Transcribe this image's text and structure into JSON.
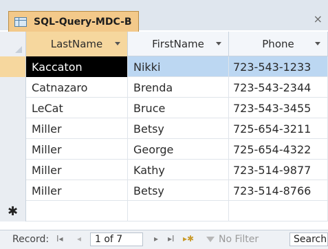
{
  "tab": {
    "title": "SQL-Query-MDC-B",
    "close": "×"
  },
  "columns": [
    "LastName",
    "FirstName",
    "Phone"
  ],
  "rows": [
    {
      "last": "Kaccaton",
      "first": "Nikki",
      "phone": "723-543-1233"
    },
    {
      "last": "Catnazaro",
      "first": "Brenda",
      "phone": "723-543-2344"
    },
    {
      "last": "LeCat",
      "first": "Bruce",
      "phone": "723-543-3455"
    },
    {
      "last": "Miller",
      "first": "Betsy",
      "phone": "725-654-3211"
    },
    {
      "last": "Miller",
      "first": "George",
      "phone": "725-654-4322"
    },
    {
      "last": "Miller",
      "first": "Kathy",
      "phone": "723-514-9877"
    },
    {
      "last": "Miller",
      "first": "Betsy",
      "phone": "723-514-8766"
    }
  ],
  "new_row_marker": "✱",
  "nav": {
    "label": "Record:",
    "first": "I◂",
    "prev": "◂",
    "position": "1 of 7",
    "next": "▸",
    "last": "▸I",
    "new": "▸✱",
    "filter": "No Filter",
    "search": "Search"
  }
}
